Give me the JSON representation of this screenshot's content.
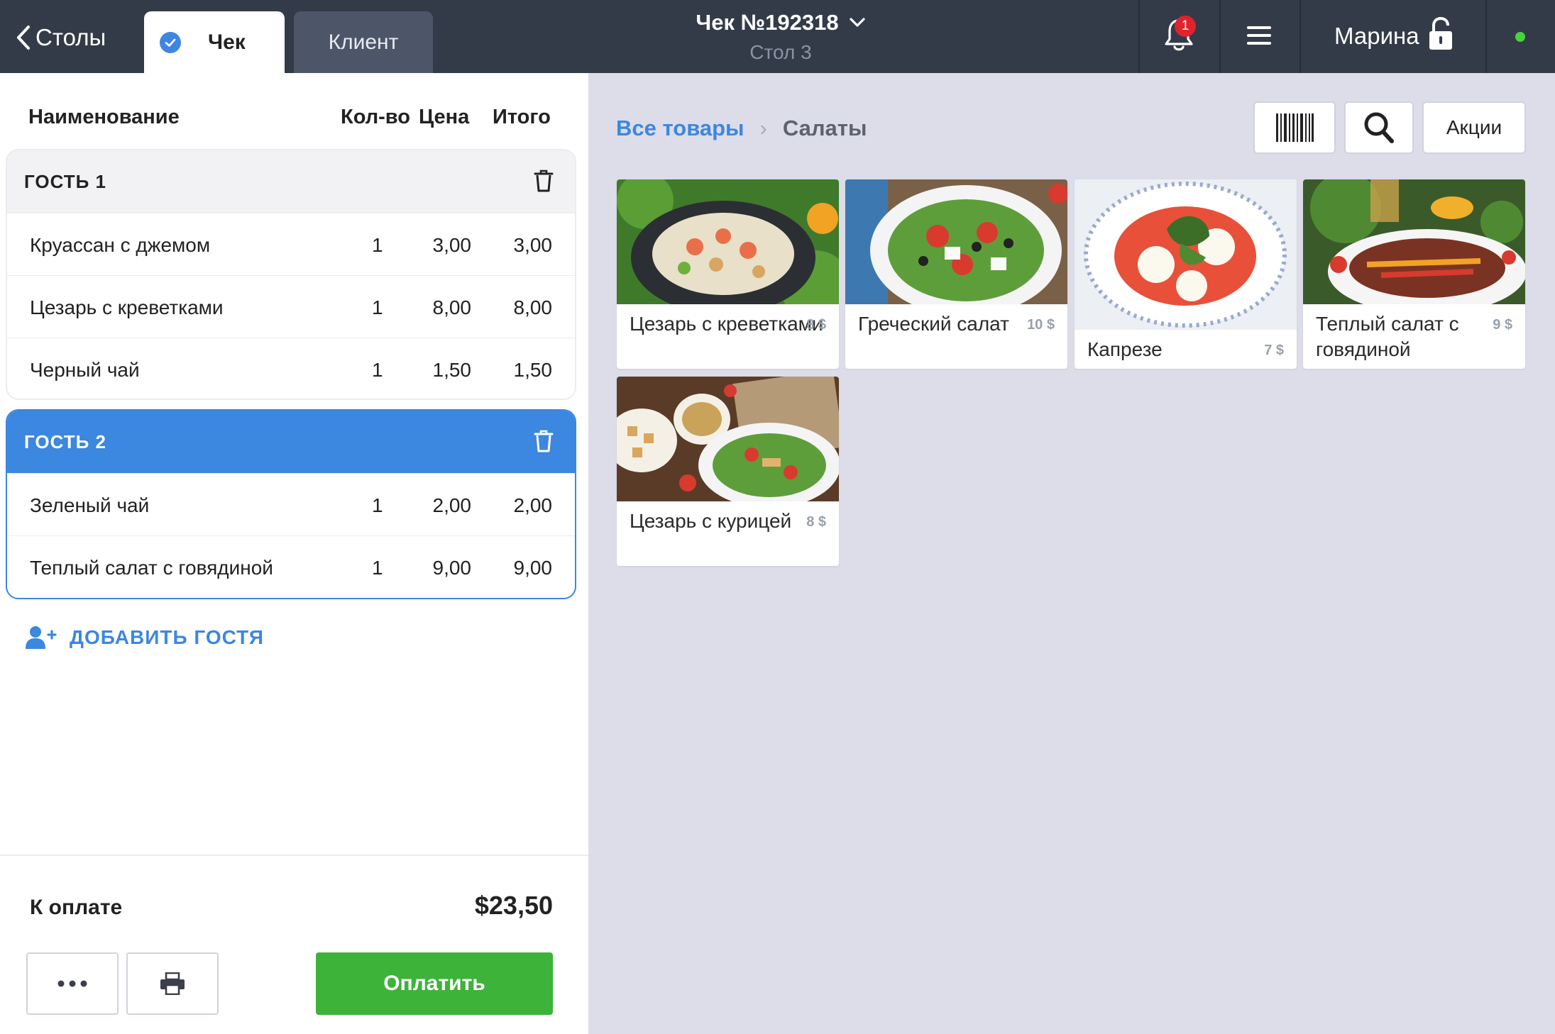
{
  "header": {
    "back_label": "Столы",
    "tab_check": "Чек",
    "tab_client": "Клиент",
    "check_title": "Чек №192318",
    "table_label": "Стол 3",
    "notifications_count": "1",
    "user_name": "Марина"
  },
  "order": {
    "columns": {
      "name": "Наименование",
      "qty": "Кол-во",
      "price": "Цена",
      "total": "Итого"
    },
    "guests": [
      {
        "label": "ГОСТЬ 1",
        "items": [
          {
            "name": "Круассан с джемом",
            "qty": "1",
            "price": "3,00",
            "total": "3,00"
          },
          {
            "name": "Цезарь с креветками",
            "qty": "1",
            "price": "8,00",
            "total": "8,00"
          },
          {
            "name": "Черный чай",
            "qty": "1",
            "price": "1,50",
            "total": "1,50"
          }
        ]
      },
      {
        "label": "ГОСТЬ 2",
        "items": [
          {
            "name": "Зеленый чай",
            "qty": "1",
            "price": "2,00",
            "total": "2,00"
          },
          {
            "name": "Теплый салат с говядиной",
            "qty": "1",
            "price": "9,00",
            "total": "9,00"
          }
        ]
      }
    ],
    "add_guest": "ДОБАВИТЬ ГОСТЯ",
    "to_pay_label": "К оплате",
    "to_pay_total": "$23,50",
    "pay_button": "Оплатить"
  },
  "catalog": {
    "breadcrumb_root": "Все товары",
    "breadcrumb_sep": "›",
    "breadcrumb_current": "Салаты",
    "promo_button": "Акции",
    "products": [
      {
        "name": "Цезарь с креветками",
        "price": "8 $"
      },
      {
        "name": "Греческий салат",
        "price": "10 $"
      },
      {
        "name": "Капрезе",
        "price": "7 $"
      },
      {
        "name": "Теплый салат с говядиной",
        "price": "9 $"
      },
      {
        "name": "Цезарь с курицей",
        "price": "8 $"
      }
    ]
  },
  "colors": {
    "topbar": "#343b48",
    "accent_blue": "#3c87df",
    "pay_green": "#3db33a",
    "catalog_bg": "#dcdde8",
    "badge_red": "#e0232e",
    "online_green": "#47d33a"
  }
}
